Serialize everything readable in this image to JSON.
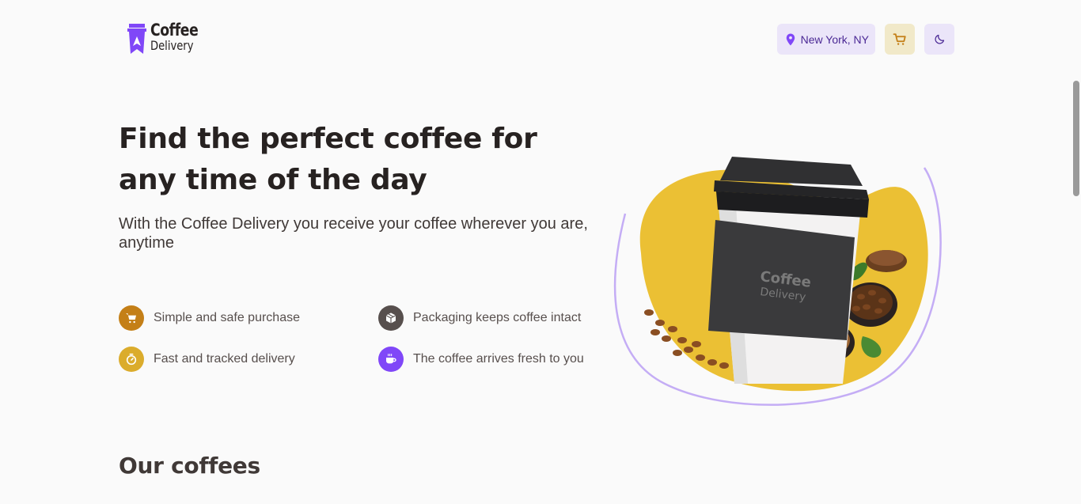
{
  "brand": {
    "line1": "Coffee",
    "line2": "Delivery",
    "color": "#8047F8"
  },
  "header": {
    "location": "New York, NY",
    "cart_icon": "cart-icon",
    "theme_icon": "moon-icon"
  },
  "hero": {
    "title": "Find the perfect coffee for any time of the day",
    "subtitle": "With the Coffee Delivery you receive your coffee wherever you are, anytime",
    "features": [
      {
        "label": "Simple and safe purchase",
        "icon": "cart-icon",
        "color": "#C47F17"
      },
      {
        "label": "Packaging keeps coffee intact",
        "icon": "package-icon",
        "color": "#574F4D"
      },
      {
        "label": "Fast and tracked delivery",
        "icon": "timer-icon",
        "color": "#DBAC2C"
      },
      {
        "label": "The coffee arrives fresh to you",
        "icon": "coffee-icon",
        "color": "#8047F8"
      }
    ],
    "image": {
      "cup_brand_line1": "Coffee",
      "cup_brand_line2": "Delivery"
    }
  },
  "section": {
    "title": "Our coffees"
  },
  "colors": {
    "yellow": "#DBAC2C",
    "yellow_dark": "#C47F17",
    "purple": "#8047F8",
    "purple_light": "#EBE5F9",
    "yellow_light": "#F1E9C9"
  }
}
